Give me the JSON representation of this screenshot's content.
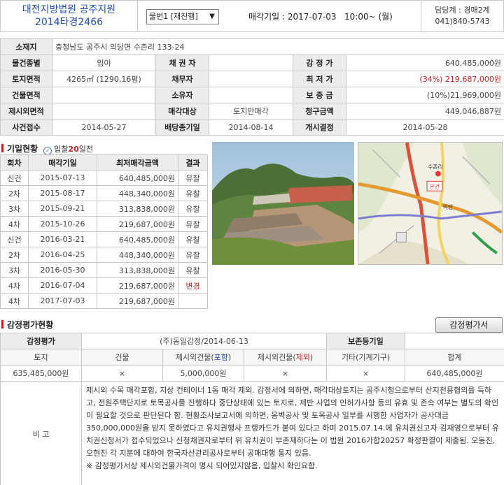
{
  "header": {
    "court": "대전지방법원 공주지원",
    "case_no": "2014타경2466",
    "item_select": "물번1 [재진행]",
    "auction_date": "매각기일 : 2017-07-03   10:00~ (월)",
    "dept": "담당계 : 경매2계",
    "phone": "041)840-5743"
  },
  "info": {
    "location_label": "소재지",
    "location": "충청남도 공주시 의당면 수촌리 133-24",
    "type_label": "물건종별",
    "type": "임야",
    "creditor_label": "채 권 자",
    "creditor": "",
    "appraisal_label": "감 정 가",
    "appraisal": "640,485,000원",
    "land_area_label": "토지면적",
    "land_area": "4265㎡ (1290,16평)",
    "debtor_label": "채무자",
    "debtor": "",
    "min_price_label": "최 저 가",
    "min_price": "(34%) 219,687,000원",
    "building_area_label": "건물면적",
    "building_area": "",
    "owner_label": "소유자",
    "owner": "",
    "deposit_label": "보 증 금",
    "deposit": "(10%)21,969,000원",
    "excluded_label": "제시외면적",
    "excluded": "",
    "sale_target_label": "매각대상",
    "sale_target": "토지만매각",
    "claim_label": "청구금액",
    "claim": "449,046,887원",
    "receipt_label": "사건접수",
    "receipt": "2014-05-27",
    "dividend_label": "배당종기일",
    "dividend": "2014-08-14",
    "start_label": "개시결정",
    "start": "2014-05-28"
  },
  "history": {
    "title": "기일현황",
    "sub_prefix": "입찰",
    "sub_num": "20",
    "sub_suffix": "일전",
    "columns": [
      "회차",
      "매각기일",
      "최저매각금액",
      "결과"
    ],
    "rows": [
      {
        "round": "신건",
        "date": "2015-07-13",
        "price": "640,485,000원",
        "result": "유찰"
      },
      {
        "round": "2차",
        "date": "2015-08-17",
        "price": "448,340,000원",
        "result": "유찰"
      },
      {
        "round": "3차",
        "date": "2015-09-21",
        "price": "313,838,000원",
        "result": "유찰"
      },
      {
        "round": "4차",
        "date": "2015-10-26",
        "price": "219,687,000원",
        "result": "유찰"
      },
      {
        "round": "신건",
        "date": "2016-03-21",
        "price": "640,485,000원",
        "result": "유찰"
      },
      {
        "round": "2차",
        "date": "2016-04-25",
        "price": "448,340,000원",
        "result": "유찰"
      },
      {
        "round": "3차",
        "date": "2016-05-30",
        "price": "313,838,000원",
        "result": "유찰"
      },
      {
        "round": "4차",
        "date": "2016-07-04",
        "price": "219,687,000원",
        "result": "변경"
      },
      {
        "round": "4차",
        "date": "2017-07-03",
        "price": "219,687,000원",
        "result": ""
      }
    ]
  },
  "map": {
    "pin_label": "본건",
    "place1": "수촌리",
    "place2": "의당"
  },
  "appraisal": {
    "title": "감정평가현황",
    "button": "감정평가서",
    "row1_label": "감정평가",
    "row1_value": "(주)동일감정/2014-06-13",
    "row1_label2": "보존등기일",
    "row1_value2": "",
    "col_land": "토지",
    "col_building": "건물",
    "col_incl_prefix": "제시외건물(",
    "col_incl_word": "포함",
    "col_excl_prefix": "제시외건물(",
    "col_excl_word": "제외",
    "col_close": ")",
    "col_other": "기타(기계기구)",
    "col_total": "합계",
    "val_land": "635,485,000원",
    "val_building": "×",
    "val_incl": "5,000,000원",
    "val_excl": "×",
    "val_other": "×",
    "val_total": "640,485,000원",
    "note_label": "비 고",
    "note": "제시외 수목 매각포함, 지상 컨테이너 1동 매각 제외. 감정서에 의하면, 매각대상토지는 공주시청으로부터 산지전용협의를 득하고, 전원주택단지로 토목공사를 진행하다 중단상태에 있는 토지로, 제반 사업의 인허가사항 등의 유효 및 존속 여부는 별도의 확인이 필요할 것으로 판단된다 함. 현황조사보고서에 의하면, 옹벽공사 및 토목공사 일부를 시행한 사업자가 공사대금 350,000,000원을 받지 못하였다고 유치권행사 프랭카드가 붙여 있다고 하며 2015.07.14.에 유치권신고자 김재영으로부터 유치권신청서가 접수되었으나 신청채권자로부터 위 유치권이 부존재하다는 이 법원 2016가합20257 확정판결이 제출됨. 오동진, 오현진 각 지분에 대하여 한국자산관리공사로부터 공매대행 통지 있음.",
    "note2": "※ 감정평가서상 제시외건물가격이 명시 되어있지않음, 입찰시 확인요함."
  },
  "colors": {
    "court_blue": "#2250b8",
    "accent_red": "#c81e1e",
    "label_bg": "#ececec"
  }
}
